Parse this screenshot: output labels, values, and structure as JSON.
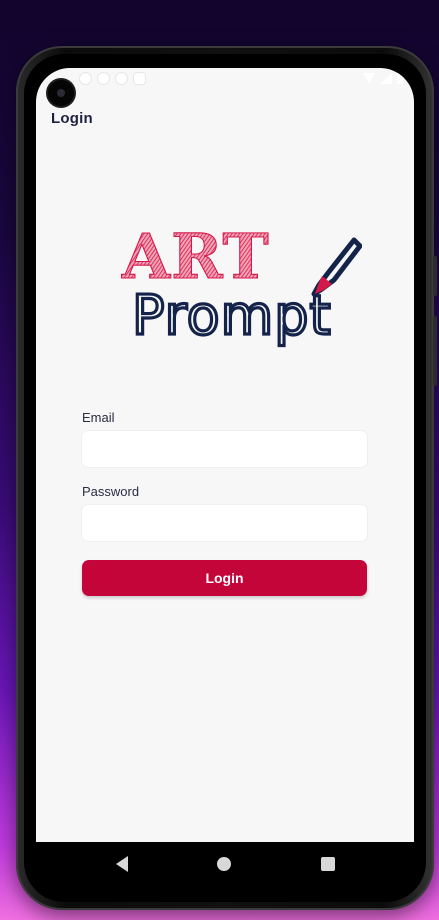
{
  "app": {
    "title": "Login",
    "logo_text": {
      "line1": "ART",
      "line2": "Prompt"
    }
  },
  "form": {
    "email_label": "Email",
    "email_value": "",
    "password_label": "Password",
    "password_value": "",
    "submit_label": "Login"
  },
  "colors": {
    "accent": "#c4053a",
    "logo_red": "#d4194a",
    "logo_navy": "#14234a",
    "screen_bg": "#f7f7f8"
  },
  "system_nav": {
    "back": "back-icon",
    "home": "home-icon",
    "recents": "recents-icon"
  }
}
